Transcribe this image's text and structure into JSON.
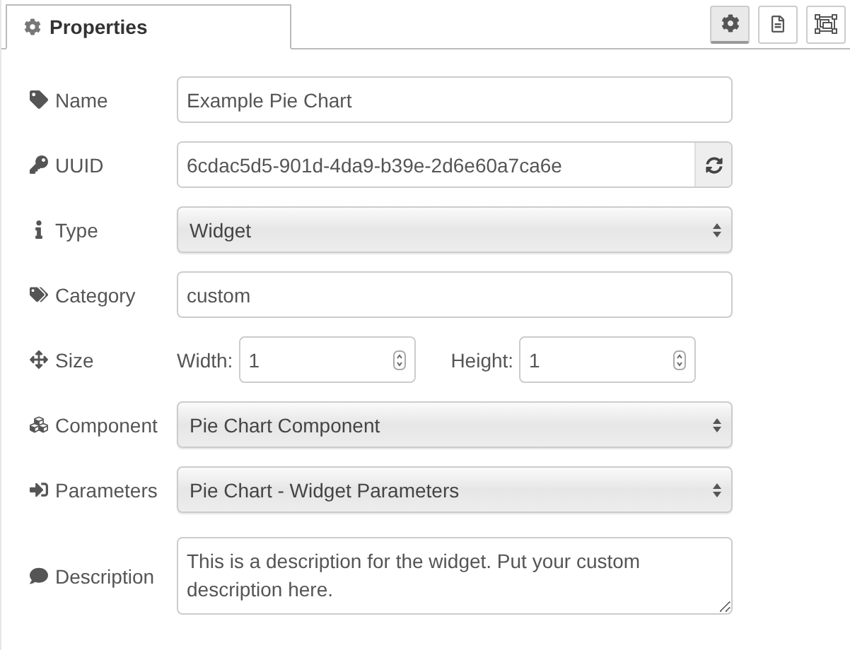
{
  "tabs": [
    {
      "label": "Properties",
      "selected": true
    }
  ],
  "toolbar_buttons": [
    {
      "kind": "settings",
      "selected": true
    },
    {
      "kind": "info",
      "selected": false
    },
    {
      "kind": "appearance",
      "selected": false
    }
  ],
  "fields": [
    {
      "kind": "text",
      "label": "Name",
      "value": "Example Pie Chart"
    },
    {
      "kind": "uuid",
      "label": "UUID",
      "value": "6cdac5d5-901d-4da9-b39e-2d6e60a7ca6e"
    },
    {
      "kind": "select",
      "label": "Type",
      "value": "Widget"
    },
    {
      "kind": "text",
      "label": "Category",
      "value": "custom"
    },
    {
      "kind": "size",
      "label": "Size",
      "width_label": "Width:",
      "width_value": "1",
      "height_label": "Height:",
      "height_value": "1"
    },
    {
      "kind": "select",
      "label": "Component",
      "value": "Pie Chart Component"
    },
    {
      "kind": "select",
      "label": "Parameters",
      "value": "Pie Chart - Widget Parameters"
    },
    {
      "kind": "textarea",
      "label": "Description",
      "value": "This is a description for the widget. Put your custom description here."
    }
  ]
}
